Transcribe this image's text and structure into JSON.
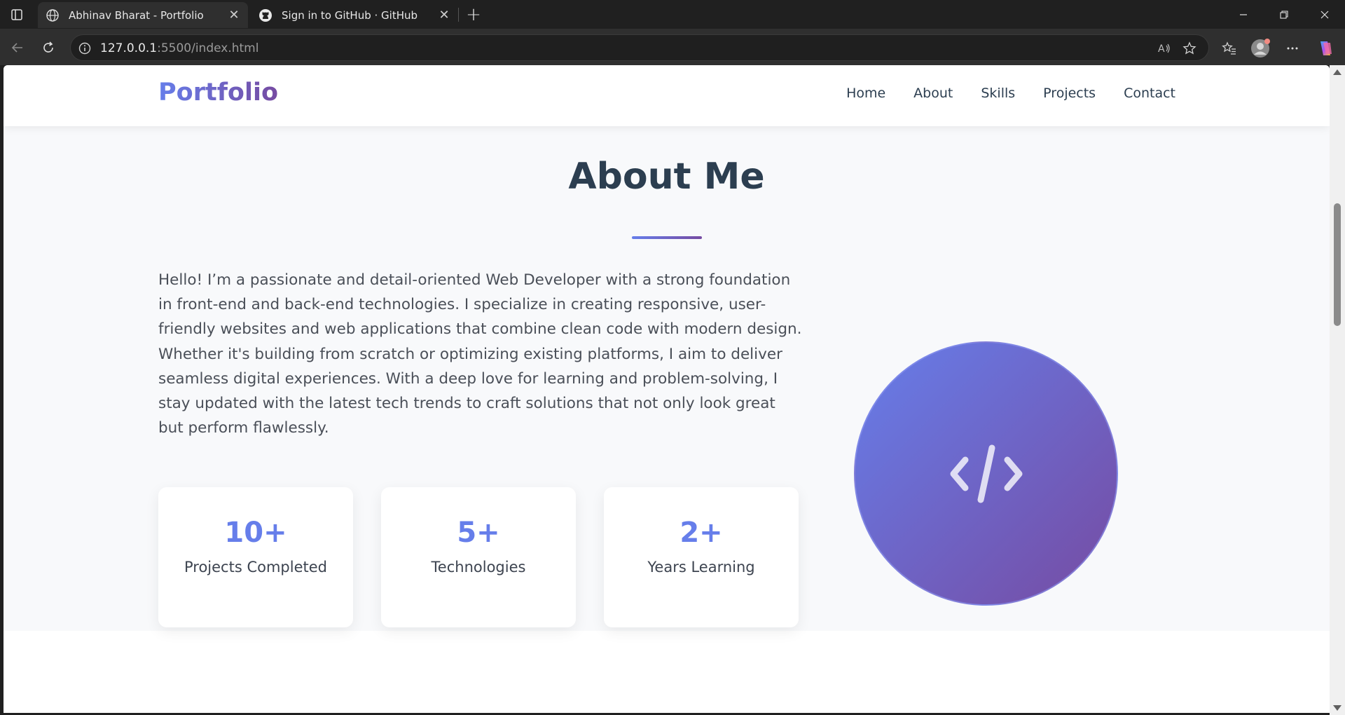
{
  "browser": {
    "tabs": [
      {
        "title": "Abhinav Bharat - Portfolio",
        "icon": "globe-icon",
        "active": true
      },
      {
        "title": "Sign in to GitHub · GitHub",
        "icon": "github-icon",
        "active": false
      }
    ],
    "url_host": "127.0.0.1",
    "url_rest": ":5500/index.html"
  },
  "site": {
    "logo": "Portfolio",
    "nav": [
      "Home",
      "About",
      "Skills",
      "Projects",
      "Contact"
    ],
    "about": {
      "heading": "About Me",
      "paragraph": "Hello! I’m a passionate and detail-oriented Web Developer with a strong foundation in front-end and back-end technologies. I specialize in creating responsive, user-friendly websites and web applications that combine clean code with modern design. Whether it's building from scratch or optimizing existing platforms, I aim to deliver seamless digital experiences. With a deep love for learning and problem-solving, I stay updated with the latest tech trends to craft solutions that not only look great but perform flawlessly.",
      "stats": [
        {
          "value": "10+",
          "label": "Projects Completed"
        },
        {
          "value": "5+",
          "label": "Technologies"
        },
        {
          "value": "2+",
          "label": "Years Learning"
        }
      ],
      "avatar_icon": "code-icon"
    }
  },
  "colors": {
    "accent_start": "#667eea",
    "accent_end": "#764ba2",
    "heading": "#2c3e50"
  }
}
